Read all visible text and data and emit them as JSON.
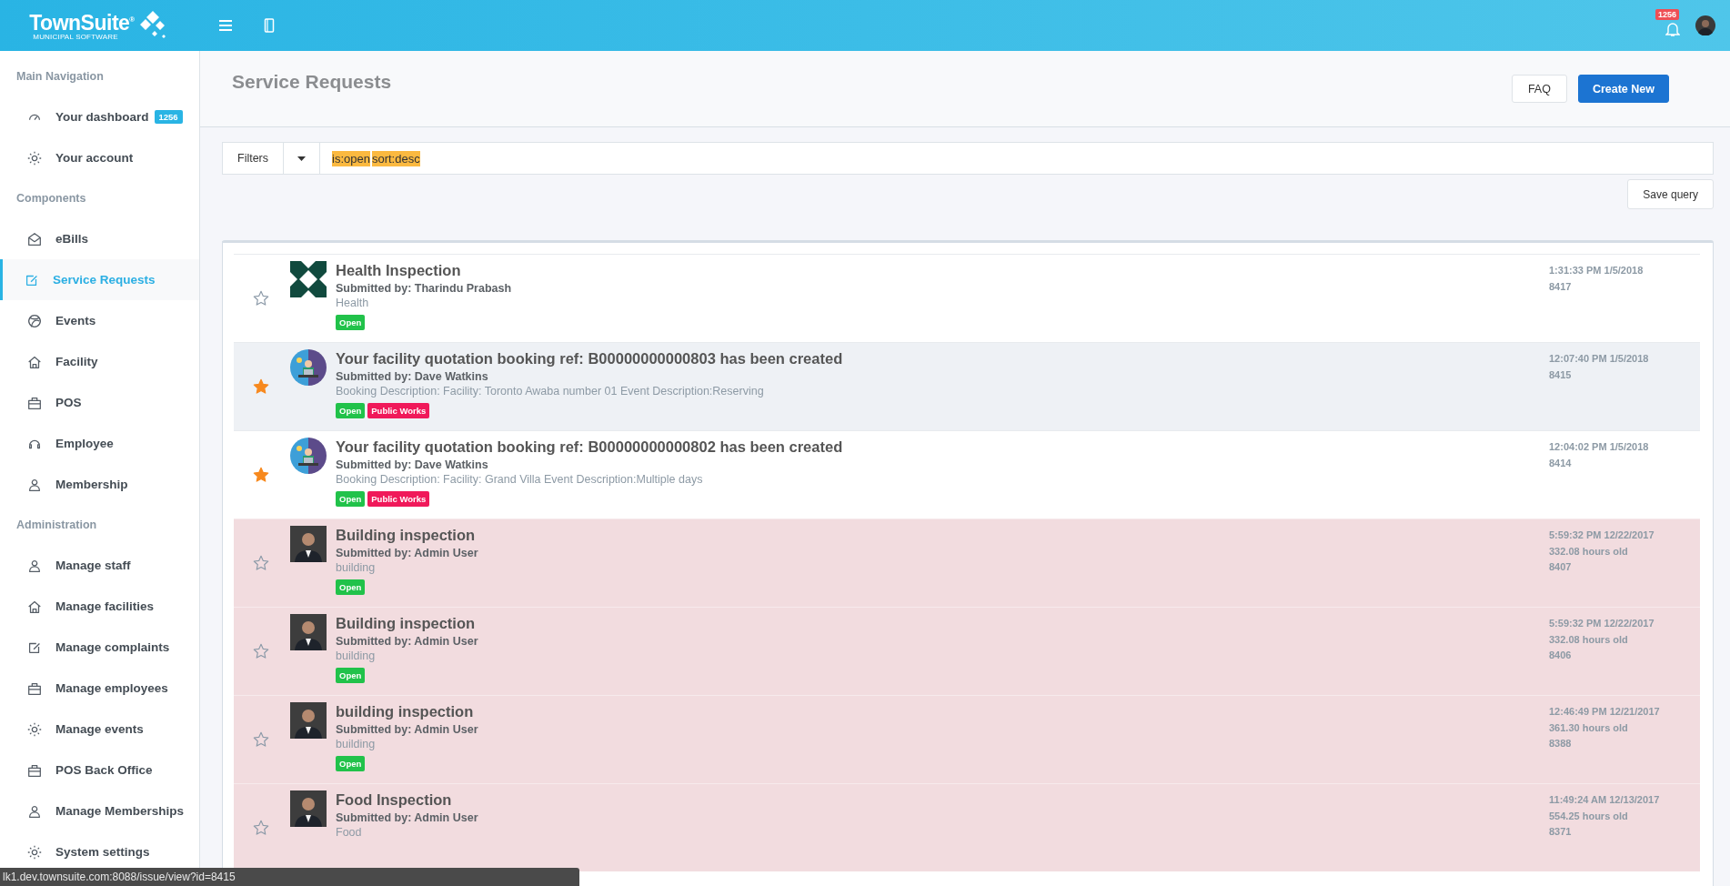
{
  "topbar": {
    "logo": {
      "name": "TownSuite$^{®}$",
      "tagline": "MUNICIPAL SOFTWARE"
    },
    "notifications": {
      "count": "1256"
    }
  },
  "sidebar": {
    "sections": [
      {
        "heading": "Main Navigation",
        "items": [
          {
            "label": "Your dashboard",
            "badge": "1256",
            "selected": false
          },
          {
            "label": "Your account",
            "selected": false
          }
        ]
      },
      {
        "heading": "Components",
        "items": [
          {
            "label": "eBills",
            "selected": false
          },
          {
            "label": "Service Requests",
            "selected": true
          },
          {
            "label": "Events",
            "selected": false
          },
          {
            "label": "Facility",
            "selected": false
          },
          {
            "label": "POS",
            "selected": false
          },
          {
            "label": "Employee",
            "selected": false
          },
          {
            "label": "Membership",
            "selected": false
          }
        ]
      },
      {
        "heading": "Administration",
        "items": [
          {
            "label": "Manage staff",
            "selected": false
          },
          {
            "label": "Manage facilities",
            "selected": false
          },
          {
            "label": "Manage complaints",
            "selected": false
          },
          {
            "label": "Manage employees",
            "selected": false
          },
          {
            "label": "Manage events",
            "selected": false
          },
          {
            "label": "POS Back Office",
            "selected": false
          },
          {
            "label": "Manage Memberships",
            "selected": false
          },
          {
            "label": "System settings",
            "selected": false
          }
        ]
      }
    ]
  },
  "page": {
    "title": "Service Requests",
    "buttons": [
      {
        "label": "FAQ",
        "kind": "default"
      },
      {
        "label": "Create New",
        "kind": "primary"
      }
    ]
  },
  "filter": {
    "button": "Filters",
    "query": [
      "is:open",
      "sort:desc"
    ],
    "save_button": "Save query"
  },
  "requests": [
    {
      "title": "Health Inspection",
      "submitted_by": "Submitted by: Tharindu Prabash",
      "description": "Health",
      "tags": [
        {
          "label": "Open",
          "color": "#21c24a"
        }
      ],
      "starred": false,
      "kind": "pattern",
      "overdue": false,
      "highlighted": false,
      "time": "1:31:33 PM 1/5/2018",
      "id": "8417"
    },
    {
      "title": "Your facility quotation booking ref: B00000000000803 has been created",
      "submitted_by": "Submitted by: Dave Watkins",
      "description": "Booking Description: Facility: Toronto Awaba number 01 Event Description:Reserving",
      "tags": [
        {
          "label": "Open",
          "color": "#21c24a"
        },
        {
          "label": "Public Works",
          "color": "#f0195a"
        }
      ],
      "starred": true,
      "kind": "illustration",
      "overdue": false,
      "highlighted": true,
      "time": "12:07:40 PM 1/5/2018",
      "id": "8415"
    },
    {
      "title": "Your facility quotation booking ref: B00000000000802 has been created",
      "submitted_by": "Submitted by: Dave Watkins",
      "description": "Booking Description: Facility: Grand Villa Event Description:Multiple days",
      "tags": [
        {
          "label": "Open",
          "color": "#21c24a"
        },
        {
          "label": "Public Works",
          "color": "#f0195a"
        }
      ],
      "starred": true,
      "kind": "illustration",
      "overdue": false,
      "highlighted": false,
      "time": "12:04:02 PM 1/5/2018",
      "id": "8414"
    },
    {
      "title": "Building inspection",
      "submitted_by": "Submitted by: Admin User",
      "description": "building",
      "tags": [
        {
          "label": "Open",
          "color": "#21c24a"
        }
      ],
      "starred": false,
      "kind": "photo",
      "overdue": true,
      "highlighted": false,
      "time": "5:59:32 PM 12/22/2017",
      "age": "332.08 hours old",
      "id": "8407"
    },
    {
      "title": "Building inspection",
      "submitted_by": "Submitted by: Admin User",
      "description": "building",
      "tags": [
        {
          "label": "Open",
          "color": "#21c24a"
        }
      ],
      "starred": false,
      "kind": "photo",
      "overdue": true,
      "highlighted": false,
      "time": "5:59:32 PM 12/22/2017",
      "age": "332.08 hours old",
      "id": "8406"
    },
    {
      "title": "building inspection",
      "submitted_by": "Submitted by: Admin User",
      "description": "building",
      "tags": [
        {
          "label": "Open",
          "color": "#21c24a"
        }
      ],
      "starred": false,
      "kind": "photo",
      "overdue": true,
      "highlighted": false,
      "time": "12:46:49 PM 12/21/2017",
      "age": "361.30 hours old",
      "id": "8388"
    },
    {
      "title": "Food Inspection",
      "submitted_by": "Submitted by: Admin User",
      "description": "Food",
      "starred": false,
      "kind": "photo",
      "overdue": true,
      "highlighted": false,
      "time": "11:49:24 AM 12/13/2017",
      "age": "554.25 hours old",
      "id": "8371"
    }
  ],
  "status_bar": {
    "url": "lk1.dev.townsuite.com:8088/issue/view?id=8415"
  }
}
